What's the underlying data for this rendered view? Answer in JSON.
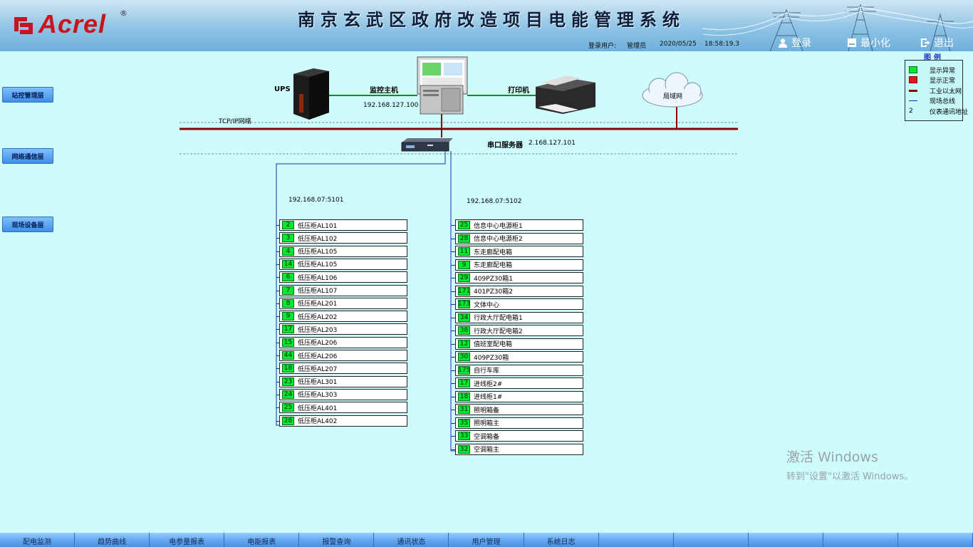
{
  "header": {
    "logo_text": "Acrel",
    "logo_reg": "®",
    "title": "南京玄武区政府改造项目电能管理系统",
    "login_user_label": "登录用户:",
    "login_user": "管理员",
    "date": "2020/05/25",
    "time": "18:58:19.3",
    "login_btn": "登录",
    "minimize_btn": "最小化",
    "exit_btn": "退出"
  },
  "sidebar": {
    "items": [
      {
        "label": "站控管理层"
      },
      {
        "label": "网络通信层"
      },
      {
        "label": "现场设备层"
      }
    ]
  },
  "legend": {
    "title": "图例",
    "items": [
      {
        "label": "显示异常",
        "color": "#00e832"
      },
      {
        "label": "显示正常",
        "color": "#e8141c"
      },
      {
        "label": "工业以太网",
        "color": "#8b0000"
      },
      {
        "label": "现场总线",
        "color": "#1a2ca8"
      },
      {
        "label": "仪表通讯地址",
        "symbol": "2"
      }
    ]
  },
  "topology": {
    "ups": "UPS",
    "host": "监控主机",
    "host_ip": "192.168.127.100",
    "printer": "打印机",
    "lan": "局域网",
    "network": "TCP/IP网络",
    "server": "串口服务器",
    "server_ip": "2.168.127.101",
    "port1": "192.168.07:5101",
    "port2": "192.168.07:5102"
  },
  "devices_left": [
    {
      "num": "2",
      "name": "低压柜AL101"
    },
    {
      "num": "3",
      "name": "低压柜AL102"
    },
    {
      "num": "4",
      "name": "低压柜AL105"
    },
    {
      "num": "14",
      "name": "低压柜AL105"
    },
    {
      "num": "6",
      "name": "低压柜AL106"
    },
    {
      "num": "7",
      "name": "低压柜AL107"
    },
    {
      "num": "8",
      "name": "低压柜AL201"
    },
    {
      "num": "9",
      "name": "低压柜AL202"
    },
    {
      "num": "17",
      "name": "低压柜AL203"
    },
    {
      "num": "15",
      "name": "低压柜AL206"
    },
    {
      "num": "44",
      "name": "低压柜AL206"
    },
    {
      "num": "18",
      "name": "低压柜AL207"
    },
    {
      "num": "23",
      "name": "低压柜AL301"
    },
    {
      "num": "24",
      "name": "低压柜AL303"
    },
    {
      "num": "25",
      "name": "低压柜AL401"
    },
    {
      "num": "28",
      "name": "低压柜AL402"
    }
  ],
  "devices_right": [
    {
      "num": "25",
      "name": "信息中心电源柜1"
    },
    {
      "num": "28",
      "name": "信息中心电源柜2"
    },
    {
      "num": "11",
      "name": "东走廊配电箱"
    },
    {
      "num": "9",
      "name": "东走廊配电箱"
    },
    {
      "num": "29",
      "name": "409PZ30箱1"
    },
    {
      "num": "171",
      "name": "401PZ30箱2"
    },
    {
      "num": "173",
      "name": "文体中心"
    },
    {
      "num": "34",
      "name": "行政大厅配电箱1"
    },
    {
      "num": "38",
      "name": "行政大厅配电箱2"
    },
    {
      "num": "12",
      "name": "值班室配电箱"
    },
    {
      "num": "30",
      "name": "409PZ30箱"
    },
    {
      "num": "175",
      "name": "自行车库"
    },
    {
      "num": "17",
      "name": "进线柜2#"
    },
    {
      "num": "18",
      "name": "进线柜1#"
    },
    {
      "num": "31",
      "name": "照明箱备"
    },
    {
      "num": "35",
      "name": "照明箱主"
    },
    {
      "num": "33",
      "name": "空调箱备"
    },
    {
      "num": "32",
      "name": "空调箱主"
    }
  ],
  "activation": {
    "line1": "激活 Windows",
    "line2": "转到\"设置\"以激活 Windows。"
  },
  "bottom_nav": [
    {
      "label": "配电监测"
    },
    {
      "label": "趋势曲线"
    },
    {
      "label": "电参量报表"
    },
    {
      "label": "电能报表"
    },
    {
      "label": "报警查询"
    },
    {
      "label": "通讯状态"
    },
    {
      "label": "用户管理"
    },
    {
      "label": "系统日志"
    },
    {
      "label": ""
    },
    {
      "label": ""
    },
    {
      "label": ""
    },
    {
      "label": ""
    },
    {
      "label": ""
    }
  ]
}
